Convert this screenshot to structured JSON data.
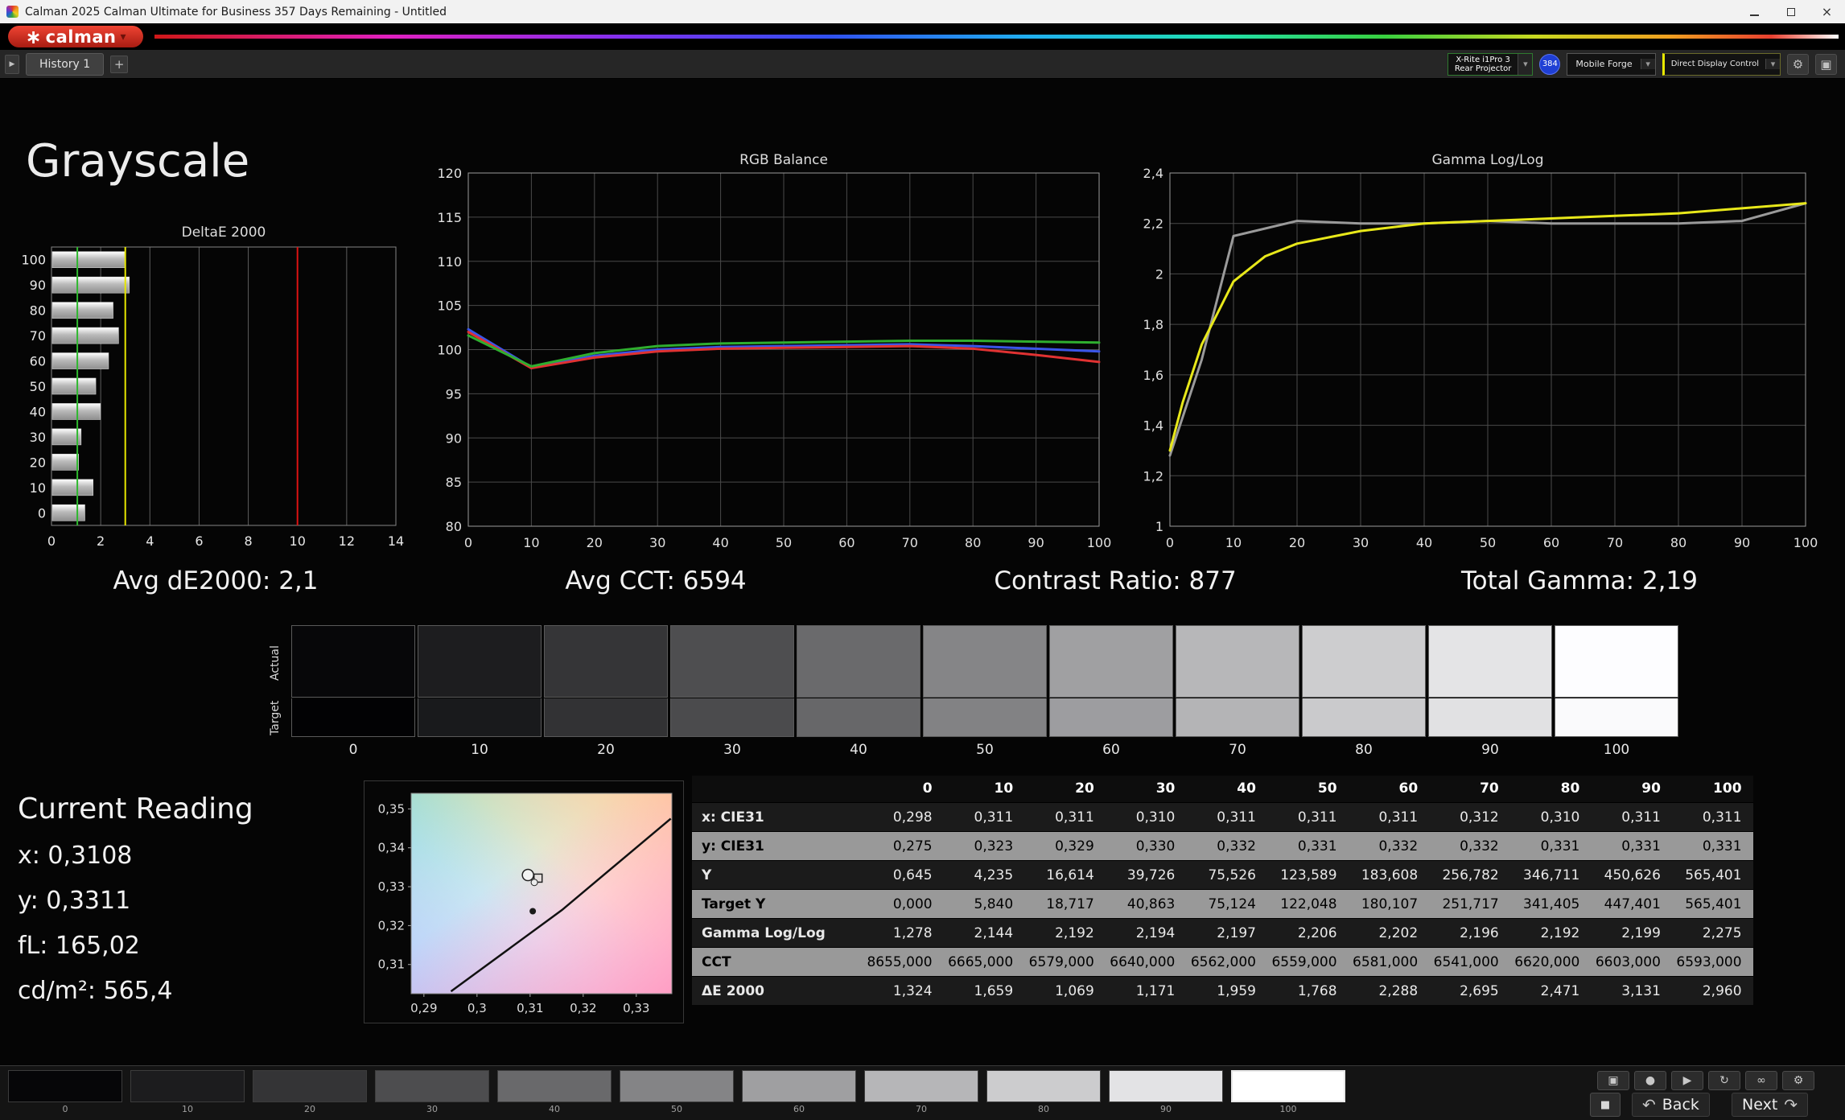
{
  "window": {
    "title": "Calman 2025 Calman Ultimate for Business 357 Days Remaining  - Untitled"
  },
  "brand": {
    "logo_text": "calman"
  },
  "toolbar": {
    "history_tab": "History 1",
    "meter_line1": "X-Rite i1Pro 3",
    "meter_line2": "Rear Projector",
    "badge": "384",
    "source": "Mobile Forge",
    "display_control": "Direct Display Control"
  },
  "page": {
    "title": "Grayscale"
  },
  "stats": [
    {
      "text": "Avg dE2000: 2,1"
    },
    {
      "text": "Avg CCT: 6594"
    },
    {
      "text": "Contrast Ratio: 877"
    },
    {
      "text": "Total Gamma: 2,19"
    }
  ],
  "current_reading": {
    "title": "Current Reading",
    "lines": [
      "x: 0,3108",
      "y: 0,3311",
      "fL: 165,02",
      "cd/m²: 565,4"
    ]
  },
  "swatches": {
    "actual_label": "Actual",
    "target_label": "Target",
    "levels": [
      {
        "label": "0",
        "actual": "#070709",
        "target": "#020204"
      },
      {
        "label": "10",
        "actual": "#1d1d1f",
        "target": "#191a1c"
      },
      {
        "label": "20",
        "actual": "#353537",
        "target": "#323234"
      },
      {
        "label": "30",
        "actual": "#4e4e50",
        "target": "#4b4b4d"
      },
      {
        "label": "40",
        "actual": "#6a6a6c",
        "target": "#676769"
      },
      {
        "label": "50",
        "actual": "#858587",
        "target": "#828284"
      },
      {
        "label": "60",
        "actual": "#a0a0a2",
        "target": "#9d9da0"
      },
      {
        "label": "70",
        "actual": "#b7b7b9",
        "target": "#b4b4b6"
      },
      {
        "label": "80",
        "actual": "#cdcdcf",
        "target": "#cacacc"
      },
      {
        "label": "90",
        "actual": "#e4e4e6",
        "target": "#e1e1e3"
      },
      {
        "label": "100",
        "actual": "#fdfdff",
        "target": "#fafafc"
      }
    ]
  },
  "table": {
    "columns": [
      "0",
      "10",
      "20",
      "30",
      "40",
      "50",
      "60",
      "70",
      "80",
      "90",
      "100"
    ],
    "rows": [
      {
        "label": "x: CIE31",
        "values": [
          "0,298",
          "0,311",
          "0,311",
          "0,310",
          "0,311",
          "0,311",
          "0,311",
          "0,312",
          "0,310",
          "0,311",
          "0,311"
        ]
      },
      {
        "label": "y: CIE31",
        "values": [
          "0,275",
          "0,323",
          "0,329",
          "0,330",
          "0,332",
          "0,331",
          "0,332",
          "0,332",
          "0,331",
          "0,331",
          "0,331"
        ]
      },
      {
        "label": "Y",
        "values": [
          "0,645",
          "4,235",
          "16,614",
          "39,726",
          "75,526",
          "123,589",
          "183,608",
          "256,782",
          "346,711",
          "450,626",
          "565,401"
        ]
      },
      {
        "label": "Target Y",
        "values": [
          "0,000",
          "5,840",
          "18,717",
          "40,863",
          "75,124",
          "122,048",
          "180,107",
          "251,717",
          "341,405",
          "447,401",
          "565,401"
        ]
      },
      {
        "label": "Gamma Log/Log",
        "values": [
          "1,278",
          "2,144",
          "2,192",
          "2,194",
          "2,197",
          "2,206",
          "2,202",
          "2,196",
          "2,192",
          "2,199",
          "2,275"
        ]
      },
      {
        "label": "CCT",
        "values": [
          "8655,000",
          "6665,000",
          "6579,000",
          "6640,000",
          "6562,000",
          "6559,000",
          "6581,000",
          "6541,000",
          "6620,000",
          "6603,000",
          "6593,000"
        ]
      },
      {
        "label": "ΔE 2000",
        "values": [
          "1,324",
          "1,659",
          "1,069",
          "1,171",
          "1,959",
          "1,768",
          "2,288",
          "2,695",
          "2,471",
          "3,131",
          "2,960"
        ]
      }
    ]
  },
  "bottom": {
    "back": "Back",
    "next": "Next",
    "patches": [
      {
        "label": "0",
        "color": "#060608"
      },
      {
        "label": "10",
        "color": "#1c1c1e"
      },
      {
        "label": "20",
        "color": "#343436"
      },
      {
        "label": "30",
        "color": "#4d4d4f"
      },
      {
        "label": "40",
        "color": "#69696b"
      },
      {
        "label": "50",
        "color": "#848486"
      },
      {
        "label": "60",
        "color": "#9f9fa1"
      },
      {
        "label": "70",
        "color": "#b6b6b8"
      },
      {
        "label": "80",
        "color": "#ccccce"
      },
      {
        "label": "90",
        "color": "#e3e3e5"
      },
      {
        "label": "100",
        "color": "#ffffff",
        "selected": true
      }
    ]
  },
  "icons": {
    "logo_star": "∗",
    "caret": "▾",
    "expand": "▶",
    "add": "+",
    "gear": "⚙",
    "panel": "▣",
    "close": "×",
    "stop": "■",
    "back_arrow": "↶",
    "next_arrow": "↷",
    "transport": [
      {
        "name": "camera-icon",
        "glyph": "▣"
      },
      {
        "name": "record-icon",
        "glyph": "●"
      },
      {
        "name": "play-icon",
        "glyph": "▶"
      },
      {
        "name": "repeat-icon",
        "glyph": "↻"
      },
      {
        "name": "infinity-icon",
        "glyph": "∞"
      },
      {
        "name": "gear-icon",
        "glyph": "⚙"
      }
    ]
  },
  "chart_data": [
    {
      "type": "bar",
      "title": "DeltaE 2000",
      "orientation": "horizontal",
      "categories": [
        100,
        90,
        80,
        70,
        60,
        50,
        40,
        30,
        20,
        10,
        0
      ],
      "values": [
        2.96,
        3.131,
        2.471,
        2.695,
        2.288,
        1.768,
        1.959,
        1.171,
        1.069,
        1.659,
        1.324
      ],
      "xlim": [
        0,
        14
      ],
      "xticks": [
        0,
        2,
        4,
        6,
        8,
        10,
        12,
        14
      ],
      "reference_lines": [
        {
          "x": 1.05,
          "color": "#2eb82e"
        },
        {
          "x": 3,
          "color": "#e6e600"
        },
        {
          "x": 10,
          "color": "#dd1212"
        }
      ]
    },
    {
      "type": "line",
      "title": "RGB Balance",
      "x": [
        0,
        10,
        20,
        30,
        40,
        50,
        60,
        70,
        80,
        90,
        100
      ],
      "series": [
        {
          "name": "Blue",
          "color": "#3a55e8",
          "values": [
            102.3,
            98.0,
            99.3,
            100.0,
            100.3,
            100.4,
            100.5,
            100.6,
            100.4,
            100.1,
            99.8
          ]
        },
        {
          "name": "Red",
          "color": "#e03232",
          "values": [
            102.0,
            97.9,
            99.1,
            99.8,
            100.1,
            100.2,
            100.3,
            100.4,
            100.1,
            99.4,
            98.6
          ]
        },
        {
          "name": "Green",
          "color": "#2fae2f",
          "values": [
            101.6,
            98.1,
            99.6,
            100.4,
            100.7,
            100.8,
            100.9,
            101.0,
            101.0,
            100.9,
            100.8
          ]
        }
      ],
      "xlim": [
        0,
        100
      ],
      "ylim": [
        80,
        120
      ],
      "xticks": [
        0,
        10,
        20,
        30,
        40,
        50,
        60,
        70,
        80,
        90,
        100
      ],
      "yticks": [
        80,
        85,
        90,
        95,
        100,
        105,
        110,
        115,
        120
      ]
    },
    {
      "type": "line",
      "title": "Gamma Log/Log",
      "xlim": [
        0,
        100
      ],
      "ylim": [
        1,
        2.4
      ],
      "xticks": [
        0,
        10,
        20,
        30,
        40,
        50,
        60,
        70,
        80,
        90,
        100
      ],
      "yticks": [
        1,
        1.2,
        1.4,
        1.6,
        1.8,
        2,
        2.2,
        2.4
      ],
      "ytick_labels": [
        "1",
        "1,2",
        "1,4",
        "1,6",
        "1,8",
        "2",
        "2,2",
        "2,4"
      ],
      "series": [
        {
          "name": "Target",
          "color": "#9a9a9a",
          "x": [
            0,
            5,
            10,
            20,
            30,
            40,
            50,
            60,
            70,
            80,
            90,
            100
          ],
          "values": [
            1.28,
            1.66,
            2.15,
            2.21,
            2.2,
            2.2,
            2.21,
            2.2,
            2.2,
            2.2,
            2.21,
            2.28
          ]
        },
        {
          "name": "Measured",
          "color": "#e8e81a",
          "x": [
            0,
            2,
            5,
            10,
            15,
            20,
            30,
            40,
            50,
            60,
            70,
            80,
            90,
            100
          ],
          "values": [
            1.3,
            1.49,
            1.72,
            1.97,
            2.07,
            2.12,
            2.17,
            2.2,
            2.21,
            2.22,
            2.23,
            2.24,
            2.26,
            2.28
          ]
        }
      ]
    },
    {
      "type": "scatter",
      "xlim": [
        0.2876,
        0.3367
      ],
      "ylim": [
        0.3025,
        0.354
      ],
      "xticks": [
        {
          "v": 0.29,
          "label": "0,29"
        },
        {
          "v": 0.3,
          "label": "0,3"
        },
        {
          "v": 0.31,
          "label": "0,31"
        },
        {
          "v": 0.32,
          "label": "0,32"
        },
        {
          "v": 0.33,
          "label": "0,33"
        }
      ],
      "yticks": [
        {
          "v": 0.35,
          "label": "0,35"
        },
        {
          "v": 0.34,
          "label": "0,34"
        },
        {
          "v": 0.33,
          "label": "0,33"
        },
        {
          "v": 0.32,
          "label": "0,32"
        },
        {
          "v": 0.31,
          "label": "0,31"
        }
      ],
      "locus": [
        [
          0.2951,
          0.3031
        ],
        [
          0.316,
          0.324
        ],
        [
          0.3365,
          0.3475
        ]
      ],
      "points": [
        {
          "x": 0.3096,
          "y": 0.333,
          "marker": "circle-large"
        },
        {
          "x": 0.3115,
          "y": 0.3322,
          "marker": "square"
        },
        {
          "x": 0.3108,
          "y": 0.3311,
          "marker": "circle-small"
        },
        {
          "x": 0.3105,
          "y": 0.3237,
          "marker": "dot"
        }
      ]
    }
  ]
}
